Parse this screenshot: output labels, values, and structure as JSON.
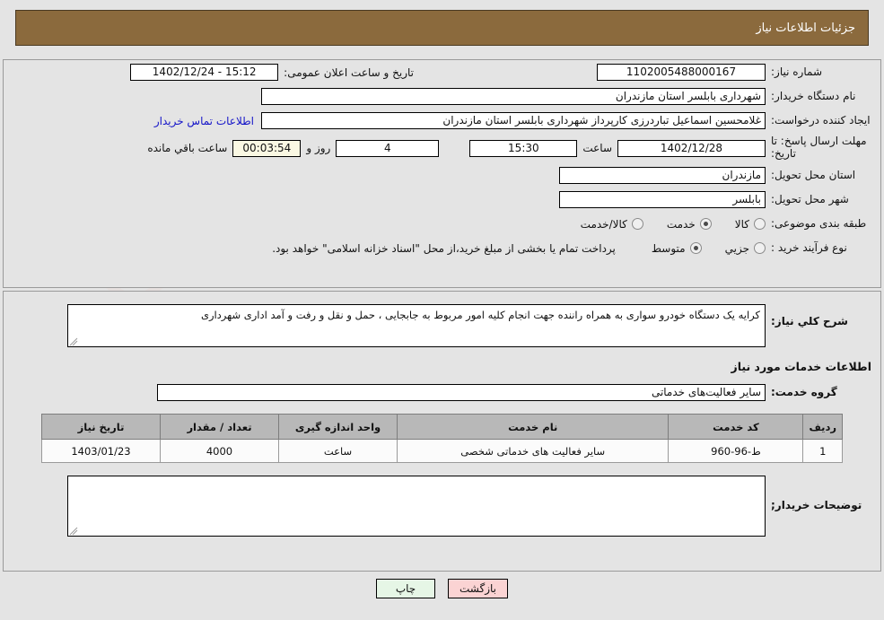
{
  "header": {
    "title": "جزئیات اطلاعات نیاز"
  },
  "colors": {
    "header_bg": "#8b6a3d",
    "panel_bg": "#e4e4e4",
    "link": "#1414c8",
    "countdown_bg": "#faf8e3",
    "table_header_bg": "#b8b8b8",
    "print_btn_bg": "#e6f6e6",
    "back_btn_bg": "#fbd3d3"
  },
  "form": {
    "need_number_label": "شماره نیاز:",
    "need_number_value": "1102005488000167",
    "public_announce_label": "تاریخ و ساعت اعلان عمومی:",
    "public_announce_value": "15:12 - 1402/12/24",
    "buyer_org_label": "نام دستگاه خریدار:",
    "buyer_org_value": "شهرداری بابلسر استان مازندران",
    "requester_label": "ایجاد کننده درخواست:",
    "requester_value": "غلامحسین اسماعیل تباردرزی کارپرداز شهرداری بابلسر استان مازندران",
    "contact_link": "اطلاعات تماس خریدار",
    "deadline_label": "مهلت ارسال پاسخ: تا تاریخ:",
    "deadline_date": "1402/12/28",
    "deadline_hour_label": "ساعت",
    "deadline_hour_value": "15:30",
    "remaining_days": "4",
    "days_and_label": "روز و",
    "remaining_time": "00:03:54",
    "remaining_suffix": "ساعت باقي مانده",
    "province_label": "استان محل تحویل:",
    "province_value": "مازندران",
    "city_label": "شهر محل تحویل:",
    "city_value": "بابلسر",
    "category_label": "طبقه بندی موضوعی:",
    "category_options": [
      "کالا",
      "خدمت",
      "کالا/خدمت"
    ],
    "category_selected": "خدمت",
    "process_label": "نوع فرآیند خرید :",
    "process_options": [
      "جزیي",
      "متوسط"
    ],
    "process_selected": "متوسط",
    "payment_note": "پرداخت تمام یا بخشی از مبلغ خرید،از محل \"اسناد خزانه اسلامی\" خواهد بود."
  },
  "description": {
    "label": "شرح کلي نیاز:",
    "value": "کرایه یک دستگاه خودرو سواری به همراه راننده جهت انجام کلیه امور مربوط به جابجایی ، حمل و نقل و رفت و آمد اداری شهرداری"
  },
  "services": {
    "section_title": "اطلاعات خدمات مورد نیاز",
    "group_label": "گروه خدمت:",
    "group_value": "سایر فعالیت‌های خدماتی",
    "columns": [
      "ردیف",
      "کد خدمت",
      "نام خدمت",
      "واحد اندازه گیری",
      "تعداد / مقدار",
      "تاریخ نیاز"
    ],
    "rows": [
      {
        "index": "1",
        "code": "ط-96-960",
        "name": "سایر فعالیت های خدماتی شخصی",
        "unit": "ساعت",
        "quantity": "4000",
        "need_date": "1403/01/23"
      }
    ]
  },
  "buyer_comments": {
    "label": "توضیحات خریدار;",
    "value": ""
  },
  "footer": {
    "print_label": "چاپ",
    "back_label": "بازگشت"
  }
}
